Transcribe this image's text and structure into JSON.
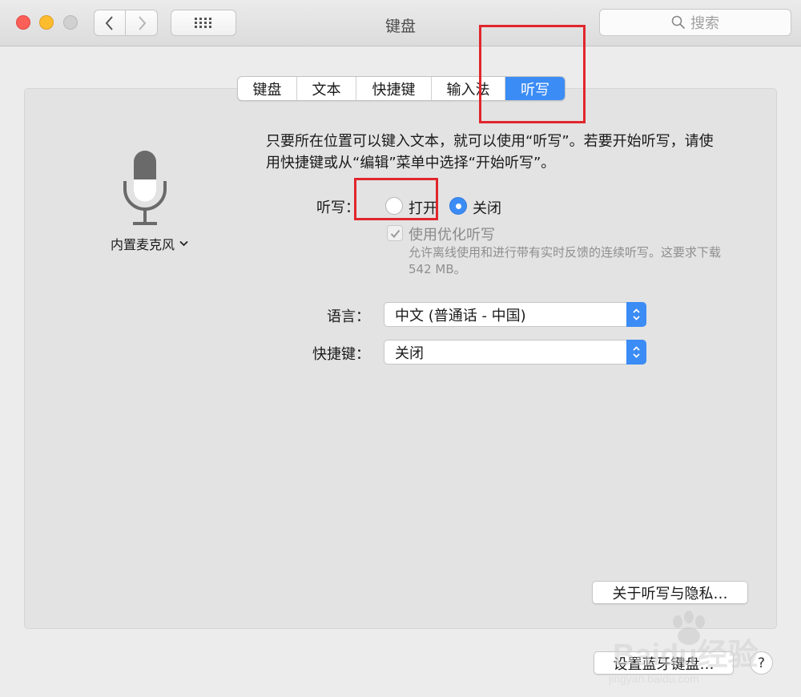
{
  "window": {
    "title": "键盘"
  },
  "toolbar": {
    "search_placeholder": "搜索"
  },
  "tabs": [
    {
      "label": "键盘",
      "active": false
    },
    {
      "label": "文本",
      "active": false
    },
    {
      "label": "快捷键",
      "active": false
    },
    {
      "label": "输入法",
      "active": false
    },
    {
      "label": "听写",
      "active": true
    }
  ],
  "mic": {
    "source_label": "内置麦克风"
  },
  "dictation": {
    "description": "只要所在位置可以键入文本，就可以使用“听写”。若要开始听写，请使用快捷键或从“编辑”菜单中选择“开始听写”。",
    "label": "听写：",
    "option_on": "打开",
    "option_off": "关闭",
    "selected": "关闭",
    "enhanced_label": "使用优化听写",
    "enhanced_checked": true,
    "enhanced_note": "允许离线使用和进行带有实时反馈的连续听写。这要求下载 542 MB。"
  },
  "language": {
    "label": "语言：",
    "value": "中文 (普通话 - 中国)"
  },
  "shortcut": {
    "label": "快捷键：",
    "value": "关闭"
  },
  "buttons": {
    "privacy": "关于听写与隐私…",
    "bluetooth": "设置蓝牙键盘…",
    "help": "?"
  },
  "watermark": {
    "text": "Baidu经验",
    "sub": "jingyan.baidu.com"
  },
  "colors": {
    "accent": "#3b8cf5",
    "annotation": "#e1262d"
  }
}
